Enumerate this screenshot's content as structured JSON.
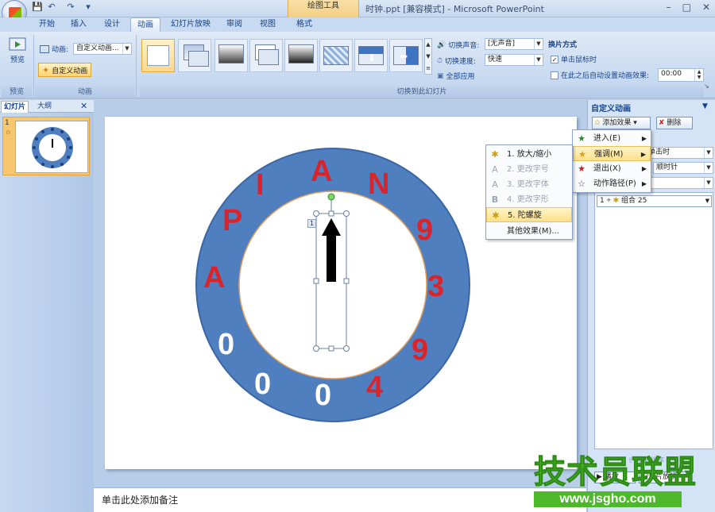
{
  "window": {
    "title": "时钟.ppt [兼容模式] - Microsoft PowerPoint",
    "context_group": "绘图工具",
    "minimize": "–",
    "maximize": "□",
    "close": "✕"
  },
  "quick_access": {
    "save": "💾",
    "undo": "↶",
    "redo": "↷",
    "more": "▾"
  },
  "tabs": [
    "开始",
    "插入",
    "设计",
    "动画",
    "幻灯片放映",
    "审阅",
    "视图",
    "格式"
  ],
  "active_tab": "动画",
  "ribbon": {
    "preview_label": "预览",
    "preview_group": "预览",
    "animation_label": "动画:",
    "animation_value": "自定义动画...",
    "custom_animation_button": "自定义动画",
    "animation_group": "动画",
    "transition_sound_label": "切换声音:",
    "transition_sound_value": "[无声音]",
    "transition_speed_label": "切换速度:",
    "transition_speed_value": "快速",
    "apply_all": "全部应用",
    "switch_group": "切换到此幻灯片",
    "advance_title": "换片方式",
    "on_click": "单击鼠标时",
    "after_auto": "在此之后自动设置动画效果:",
    "after_time": "00:00"
  },
  "left_panel": {
    "tab_slides": "幻灯片",
    "tab_outline": "大纲",
    "close": "✕",
    "slide_number": "1"
  },
  "slide": {
    "letters_red": [
      "A",
      "N",
      "9",
      "3",
      "9",
      "4",
      "P",
      "I",
      "A"
    ],
    "digits_white": [
      "0",
      "0",
      "0"
    ],
    "animation_tag": "1"
  },
  "notes": "单击此处添加备注",
  "task_pane": {
    "title": "自定义动画",
    "add_effect": "添加效果",
    "remove": "删除",
    "start_value": "单击时",
    "direction_value": "顺时针",
    "list_item_number": "1",
    "list_item_name": "组合 25",
    "reorder_label": "重新排序",
    "play": "播放",
    "slideshow": "幻灯片放映"
  },
  "effect_menu": [
    {
      "label": "进入(E)",
      "icon": "★",
      "color": "#2a8a2a"
    },
    {
      "label": "强调(M)",
      "icon": "★",
      "color": "#d8a018"
    },
    {
      "label": "退出(X)",
      "icon": "★",
      "color": "#c82020"
    },
    {
      "label": "动作路径(P)",
      "icon": "☆",
      "color": "#444"
    }
  ],
  "emphasis_menu": [
    {
      "label": "1. 放大/缩小",
      "icon": "✱",
      "disabled": false
    },
    {
      "label": "2. 更改字号",
      "icon": "A",
      "disabled": true
    },
    {
      "label": "3. 更改字体",
      "icon": "A",
      "disabled": true
    },
    {
      "label": "4. 更改字形",
      "icon": "B",
      "disabled": true
    },
    {
      "label": "5. 陀螺旋",
      "icon": "✱",
      "disabled": false,
      "highlighted": true
    },
    {
      "label": "其他效果(M)...",
      "icon": "",
      "disabled": false
    }
  ],
  "watermark": {
    "text": "技术员联盟",
    "url": "www.jsgho.com"
  },
  "colors": {
    "ring": "#4f7fbe",
    "ring_stroke": "#3a66a3",
    "inner_stroke": "#e0a060",
    "red": "#d9242c",
    "white": "#ffffff"
  }
}
